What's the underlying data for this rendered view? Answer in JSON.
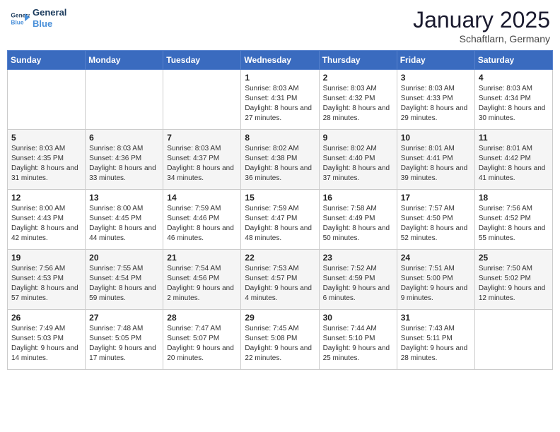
{
  "logo": {
    "text_general": "General",
    "text_blue": "Blue"
  },
  "title": "January 2025",
  "subtitle": "Schaftlarn, Germany",
  "days_of_week": [
    "Sunday",
    "Monday",
    "Tuesday",
    "Wednesday",
    "Thursday",
    "Friday",
    "Saturday"
  ],
  "weeks": [
    [
      {
        "day": "",
        "sunrise": "",
        "sunset": "",
        "daylight": ""
      },
      {
        "day": "",
        "sunrise": "",
        "sunset": "",
        "daylight": ""
      },
      {
        "day": "",
        "sunrise": "",
        "sunset": "",
        "daylight": ""
      },
      {
        "day": "1",
        "sunrise": "Sunrise: 8:03 AM",
        "sunset": "Sunset: 4:31 PM",
        "daylight": "Daylight: 8 hours and 27 minutes."
      },
      {
        "day": "2",
        "sunrise": "Sunrise: 8:03 AM",
        "sunset": "Sunset: 4:32 PM",
        "daylight": "Daylight: 8 hours and 28 minutes."
      },
      {
        "day": "3",
        "sunrise": "Sunrise: 8:03 AM",
        "sunset": "Sunset: 4:33 PM",
        "daylight": "Daylight: 8 hours and 29 minutes."
      },
      {
        "day": "4",
        "sunrise": "Sunrise: 8:03 AM",
        "sunset": "Sunset: 4:34 PM",
        "daylight": "Daylight: 8 hours and 30 minutes."
      }
    ],
    [
      {
        "day": "5",
        "sunrise": "Sunrise: 8:03 AM",
        "sunset": "Sunset: 4:35 PM",
        "daylight": "Daylight: 8 hours and 31 minutes."
      },
      {
        "day": "6",
        "sunrise": "Sunrise: 8:03 AM",
        "sunset": "Sunset: 4:36 PM",
        "daylight": "Daylight: 8 hours and 33 minutes."
      },
      {
        "day": "7",
        "sunrise": "Sunrise: 8:03 AM",
        "sunset": "Sunset: 4:37 PM",
        "daylight": "Daylight: 8 hours and 34 minutes."
      },
      {
        "day": "8",
        "sunrise": "Sunrise: 8:02 AM",
        "sunset": "Sunset: 4:38 PM",
        "daylight": "Daylight: 8 hours and 36 minutes."
      },
      {
        "day": "9",
        "sunrise": "Sunrise: 8:02 AM",
        "sunset": "Sunset: 4:40 PM",
        "daylight": "Daylight: 8 hours and 37 minutes."
      },
      {
        "day": "10",
        "sunrise": "Sunrise: 8:01 AM",
        "sunset": "Sunset: 4:41 PM",
        "daylight": "Daylight: 8 hours and 39 minutes."
      },
      {
        "day": "11",
        "sunrise": "Sunrise: 8:01 AM",
        "sunset": "Sunset: 4:42 PM",
        "daylight": "Daylight: 8 hours and 41 minutes."
      }
    ],
    [
      {
        "day": "12",
        "sunrise": "Sunrise: 8:00 AM",
        "sunset": "Sunset: 4:43 PM",
        "daylight": "Daylight: 8 hours and 42 minutes."
      },
      {
        "day": "13",
        "sunrise": "Sunrise: 8:00 AM",
        "sunset": "Sunset: 4:45 PM",
        "daylight": "Daylight: 8 hours and 44 minutes."
      },
      {
        "day": "14",
        "sunrise": "Sunrise: 7:59 AM",
        "sunset": "Sunset: 4:46 PM",
        "daylight": "Daylight: 8 hours and 46 minutes."
      },
      {
        "day": "15",
        "sunrise": "Sunrise: 7:59 AM",
        "sunset": "Sunset: 4:47 PM",
        "daylight": "Daylight: 8 hours and 48 minutes."
      },
      {
        "day": "16",
        "sunrise": "Sunrise: 7:58 AM",
        "sunset": "Sunset: 4:49 PM",
        "daylight": "Daylight: 8 hours and 50 minutes."
      },
      {
        "day": "17",
        "sunrise": "Sunrise: 7:57 AM",
        "sunset": "Sunset: 4:50 PM",
        "daylight": "Daylight: 8 hours and 52 minutes."
      },
      {
        "day": "18",
        "sunrise": "Sunrise: 7:56 AM",
        "sunset": "Sunset: 4:52 PM",
        "daylight": "Daylight: 8 hours and 55 minutes."
      }
    ],
    [
      {
        "day": "19",
        "sunrise": "Sunrise: 7:56 AM",
        "sunset": "Sunset: 4:53 PM",
        "daylight": "Daylight: 8 hours and 57 minutes."
      },
      {
        "day": "20",
        "sunrise": "Sunrise: 7:55 AM",
        "sunset": "Sunset: 4:54 PM",
        "daylight": "Daylight: 8 hours and 59 minutes."
      },
      {
        "day": "21",
        "sunrise": "Sunrise: 7:54 AM",
        "sunset": "Sunset: 4:56 PM",
        "daylight": "Daylight: 9 hours and 2 minutes."
      },
      {
        "day": "22",
        "sunrise": "Sunrise: 7:53 AM",
        "sunset": "Sunset: 4:57 PM",
        "daylight": "Daylight: 9 hours and 4 minutes."
      },
      {
        "day": "23",
        "sunrise": "Sunrise: 7:52 AM",
        "sunset": "Sunset: 4:59 PM",
        "daylight": "Daylight: 9 hours and 6 minutes."
      },
      {
        "day": "24",
        "sunrise": "Sunrise: 7:51 AM",
        "sunset": "Sunset: 5:00 PM",
        "daylight": "Daylight: 9 hours and 9 minutes."
      },
      {
        "day": "25",
        "sunrise": "Sunrise: 7:50 AM",
        "sunset": "Sunset: 5:02 PM",
        "daylight": "Daylight: 9 hours and 12 minutes."
      }
    ],
    [
      {
        "day": "26",
        "sunrise": "Sunrise: 7:49 AM",
        "sunset": "Sunset: 5:03 PM",
        "daylight": "Daylight: 9 hours and 14 minutes."
      },
      {
        "day": "27",
        "sunrise": "Sunrise: 7:48 AM",
        "sunset": "Sunset: 5:05 PM",
        "daylight": "Daylight: 9 hours and 17 minutes."
      },
      {
        "day": "28",
        "sunrise": "Sunrise: 7:47 AM",
        "sunset": "Sunset: 5:07 PM",
        "daylight": "Daylight: 9 hours and 20 minutes."
      },
      {
        "day": "29",
        "sunrise": "Sunrise: 7:45 AM",
        "sunset": "Sunset: 5:08 PM",
        "daylight": "Daylight: 9 hours and 22 minutes."
      },
      {
        "day": "30",
        "sunrise": "Sunrise: 7:44 AM",
        "sunset": "Sunset: 5:10 PM",
        "daylight": "Daylight: 9 hours and 25 minutes."
      },
      {
        "day": "31",
        "sunrise": "Sunrise: 7:43 AM",
        "sunset": "Sunset: 5:11 PM",
        "daylight": "Daylight: 9 hours and 28 minutes."
      },
      {
        "day": "",
        "sunrise": "",
        "sunset": "",
        "daylight": ""
      }
    ]
  ]
}
